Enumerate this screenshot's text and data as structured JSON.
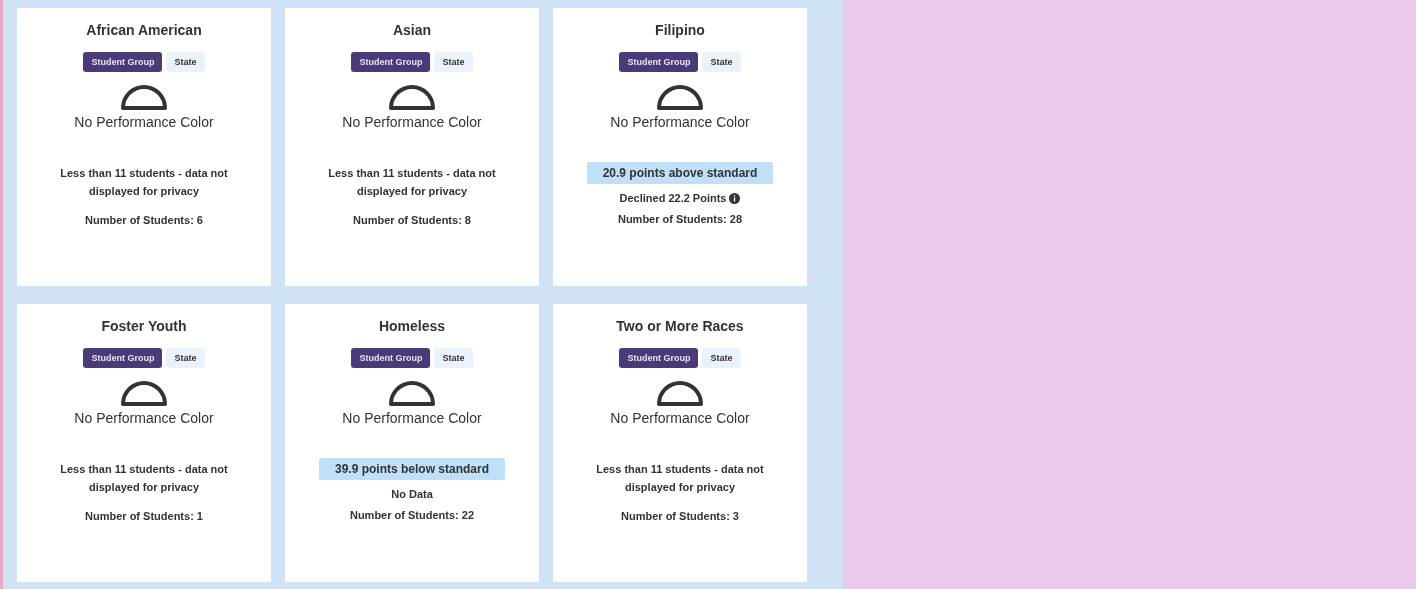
{
  "cards": [
    {
      "title": "African American",
      "tabs": [
        {
          "label": "Student Group",
          "selected": true
        },
        {
          "label": "State",
          "selected": false
        }
      ],
      "color_label": "No Performance Color",
      "kind": "privacy",
      "note": "Less than 11 students - data not displayed for privacy",
      "count": "Number of Students: 6"
    },
    {
      "title": "Asian",
      "tabs": [
        {
          "label": "Student Group",
          "selected": true
        },
        {
          "label": "State",
          "selected": false
        }
      ],
      "color_label": "No Performance Color",
      "kind": "privacy",
      "note": "Less than 11 students - data not displayed for privacy",
      "count": "Number of Students: 8"
    },
    {
      "title": "Filipino",
      "tabs": [
        {
          "label": "Student Group",
          "selected": true
        },
        {
          "label": "State",
          "selected": false
        }
      ],
      "color_label": "No Performance Color",
      "kind": "score",
      "score": "20.9 points above standard",
      "change": "Declined 22.2 Points",
      "info_icon": true,
      "count": "Number of Students: 28"
    },
    {
      "title": "Foster Youth",
      "tabs": [
        {
          "label": "Student Group",
          "selected": true
        },
        {
          "label": "State",
          "selected": false
        }
      ],
      "color_label": "No Performance Color",
      "kind": "privacy",
      "note": "Less than 11 students - data not displayed for privacy",
      "count": "Number of Students: 1"
    },
    {
      "title": "Homeless",
      "tabs": [
        {
          "label": "Student Group",
          "selected": true
        },
        {
          "label": "State",
          "selected": false
        }
      ],
      "color_label": "No Performance Color",
      "kind": "score",
      "score": "39.9 points below standard",
      "change": "No Data",
      "info_icon": false,
      "count": "Number of Students: 22"
    },
    {
      "title": "Two or More Races",
      "tabs": [
        {
          "label": "Student Group",
          "selected": true
        },
        {
          "label": "State",
          "selected": false
        }
      ],
      "color_label": "No Performance Color",
      "kind": "privacy",
      "note": "Less than 11 students - data not displayed for privacy",
      "count": "Number of Students: 3"
    }
  ]
}
